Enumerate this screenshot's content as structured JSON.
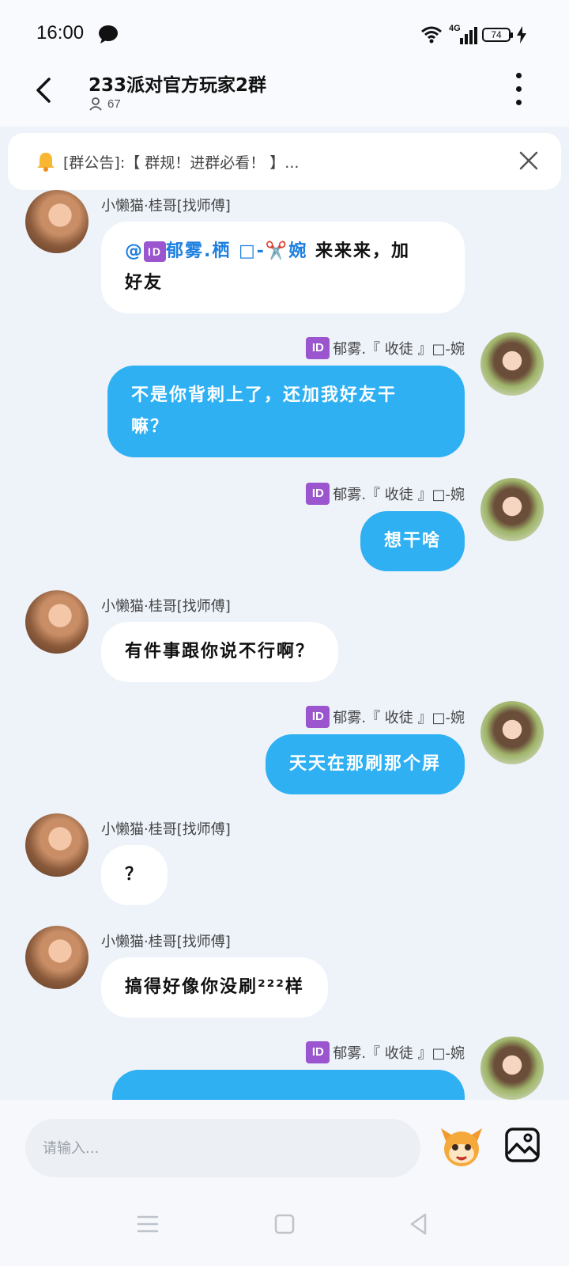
{
  "status_bar": {
    "time": "16:00",
    "network": "4G",
    "battery": "74"
  },
  "header": {
    "title": "233派对官方玩家2群",
    "member_count": "67"
  },
  "notice": {
    "text": "[群公告]:【 群规！进群必看！ 】..."
  },
  "messages": [
    {
      "side": "left",
      "sender": "小懒猫·桂哥[找师傅]",
      "mention": "@",
      "mention_name": "郁雾.栖 □-✂️婉",
      "text_after_mention": " 来来来，加",
      "text_line2": "好友"
    },
    {
      "side": "right",
      "sender": "郁雾.『 收徒 』□-婉",
      "line1": "不是你背刺上了，还加我好友干",
      "line2": "嘛？"
    },
    {
      "side": "right",
      "sender": "郁雾.『 收徒 』□-婉",
      "text": "想干啥"
    },
    {
      "side": "left",
      "sender": "小懒猫·桂哥[找师傅]",
      "text": "有件事跟你说不行啊？"
    },
    {
      "side": "right",
      "sender": "郁雾.『 收徒 』□-婉",
      "text": "天天在那刷那个屏"
    },
    {
      "side": "left",
      "sender": "小懒猫·桂哥[找师傅]",
      "text": "？"
    },
    {
      "side": "left",
      "sender": "小懒猫·桂哥[找师傅]",
      "text": "搞得好像你没刷²²²样"
    },
    {
      "side": "right",
      "sender": "郁雾.『 收徒 』□-婉",
      "text": ""
    }
  ],
  "id_badge": "ID",
  "input": {
    "placeholder": "请输入..."
  },
  "colors": {
    "accent_bubble": "#2eb0f3",
    "mention": "#1d7fe0",
    "id_badge": "#9a55cf",
    "background": "#eef3fa"
  },
  "icons": {
    "back": "back-arrow-icon",
    "more": "more-vertical-icon",
    "bell": "bell-icon",
    "close": "close-icon",
    "emoji": "mascot-emoji-icon",
    "image": "image-icon"
  }
}
